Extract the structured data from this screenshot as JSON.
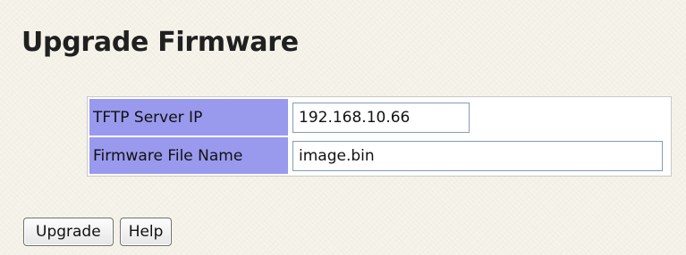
{
  "page": {
    "title": "Upgrade Firmware"
  },
  "form": {
    "rows": [
      {
        "label": "TFTP Server IP",
        "value": "192.168.10.66"
      },
      {
        "label": "Firmware File Name",
        "value": "image.bin"
      }
    ]
  },
  "buttons": {
    "upgrade_label": "Upgrade",
    "help_label": "Help"
  },
  "colors": {
    "label_background": "#9999ee",
    "page_background": "#f6f4ea",
    "input_border": "#7f9db9"
  }
}
